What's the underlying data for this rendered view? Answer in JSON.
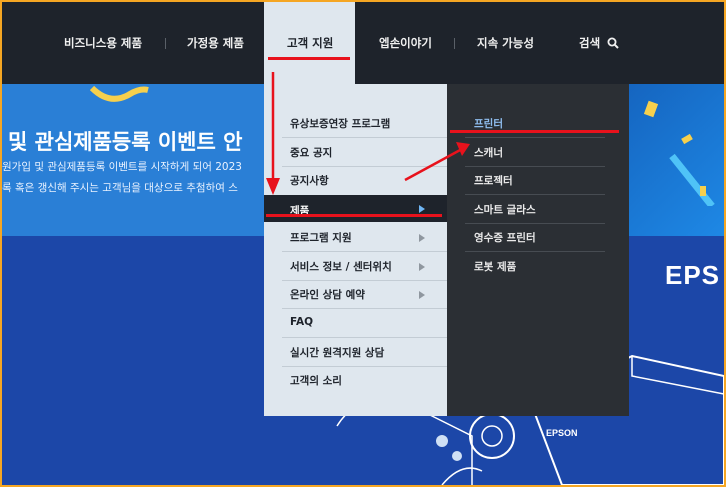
{
  "nav": {
    "items": [
      "비즈니스용 제품",
      "가정용 제품",
      "고객 지원",
      "엡손이야기",
      "지속 가능성"
    ],
    "search_label": "검색"
  },
  "banner": {
    "title": "및 관심제품등록 이벤트 안",
    "line1": "원가입 및 관심제품등록 이벤트를 시작하게 되어 2023",
    "line2": "록 혹은 갱신해 주시는 고객님을 대상으로 추첨하여 스"
  },
  "support_menu": {
    "items": [
      "유상보증연장 프로그램",
      "중요 공지",
      "공지사항",
      "제품",
      "프로그램 지원",
      "서비스 정보 / 센터위치",
      "온라인 상담 예약",
      "FAQ",
      "실시간 원격지원 상담",
      "고객의 소리"
    ]
  },
  "product_menu": {
    "items": [
      "프린터",
      "스캐너",
      "프로젝터",
      "스마트 글라스",
      "영수증 프린터",
      "로봇 제품"
    ]
  },
  "background": {
    "brand_big": "EPS",
    "brand_small": "EPSON"
  },
  "colors": {
    "accent": "#e8121c",
    "nav_bg": "#1e232b",
    "submenu_bg": "#2b2f34",
    "active_link": "#8fbef0",
    "frame": "#f5a623"
  }
}
